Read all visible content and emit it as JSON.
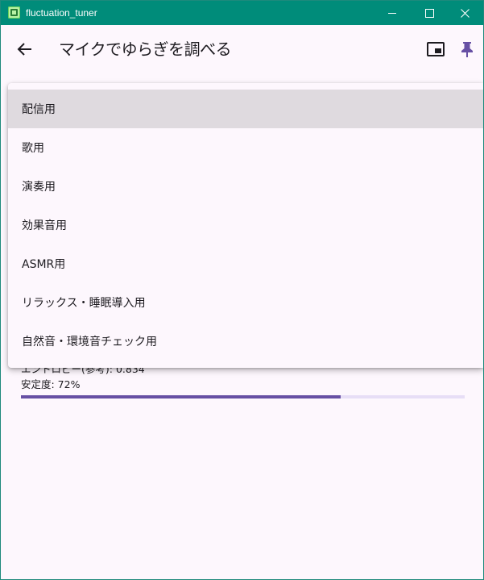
{
  "window": {
    "title": "fluctuation_tuner",
    "titlebar_color": "#008c7a"
  },
  "appbar": {
    "title": "マイクでゆらぎを調べる",
    "back_icon": "arrow-left-icon",
    "pip_icon": "picture-in-picture-icon",
    "pin_icon": "pin-icon",
    "accent_color": "#6750a4"
  },
  "dropdown": {
    "items": [
      {
        "label": "配信用",
        "selected": true
      },
      {
        "label": "歌用",
        "selected": false
      },
      {
        "label": "演奏用",
        "selected": false
      },
      {
        "label": "効果音用",
        "selected": false
      },
      {
        "label": "ASMR用",
        "selected": false
      },
      {
        "label": "リラックス・睡眠導入用",
        "selected": false
      },
      {
        "label": "自然音・環境音チェック用",
        "selected": false
      }
    ]
  },
  "stats": {
    "entropy_text": "エントロピー(参考): 0.834",
    "stability_text": "安定度: 72%",
    "stability_value": 0.72
  }
}
